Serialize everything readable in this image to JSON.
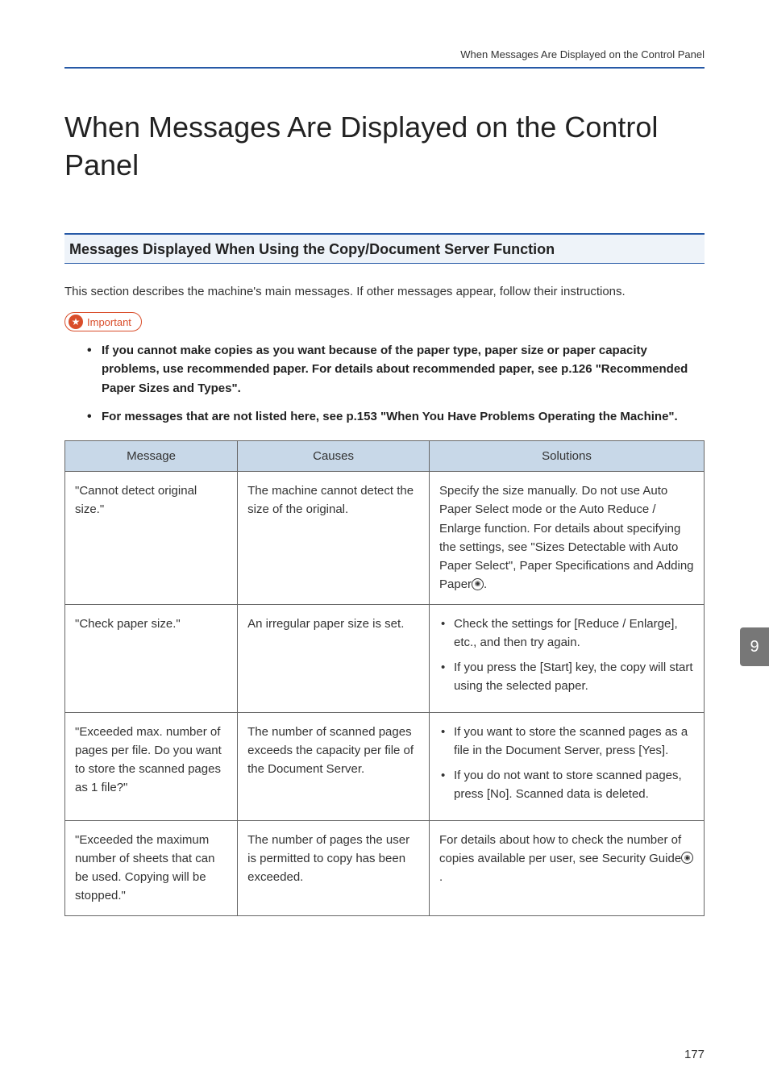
{
  "header": {
    "running_head": "When Messages Are Displayed on the Control Panel"
  },
  "title": "When Messages Are Displayed on the Control Panel",
  "section_heading": "Messages Displayed When Using the Copy/Document Server Function",
  "section_intro": "This section describes the machine's main messages. If other messages appear, follow their instructions.",
  "important": {
    "label": "Important",
    "items": [
      "If you cannot make copies as you want because of the paper type, paper size or paper capacity problems, use recommended paper. For details about recommended paper, see p.126 \"Recommended Paper Sizes and Types\".",
      "For messages that are not listed here, see p.153 \"When You Have Problems Operating the Machine\"."
    ]
  },
  "table": {
    "headers": {
      "message": "Message",
      "causes": "Causes",
      "solutions": "Solutions"
    },
    "rows": [
      {
        "message": "\"Cannot detect original size.\"",
        "causes": "The machine cannot detect the size of the original.",
        "solution_text_prefix": "Specify the size manually. Do not use Auto Paper Select mode or the Auto Reduce / Enlarge function. For details about specifying the settings, see \"Sizes Detectable with Auto Paper Select\", Paper Specifications and Adding Paper",
        "solution_text_suffix": ".",
        "solution_bullets": []
      },
      {
        "message": "\"Check paper size.\"",
        "causes": "An irregular paper size is set.",
        "solution_text_prefix": "",
        "solution_text_suffix": "",
        "solution_bullets": [
          "Check the settings for [Reduce / Enlarge], etc., and then try again.",
          "If you press the [Start] key, the copy will start using the selected paper."
        ]
      },
      {
        "message": "\"Exceeded max. number of pages per file. Do you want to store the scanned pages as 1 file?\"",
        "causes": "The number of scanned pages exceeds the capacity per file of the Document Server.",
        "solution_text_prefix": "",
        "solution_text_suffix": "",
        "solution_bullets": [
          "If you want to store the scanned pages as a file in the Document Server, press [Yes].",
          "If you do not want to store scanned pages, press [No]. Scanned data is deleted."
        ]
      },
      {
        "message": "\"Exceeded the maximum number of sheets that can be used. Copying will be stopped.\"",
        "causes": "The number of pages the user is permitted to copy has been exceeded.",
        "solution_text_prefix": "For details about how to check the number of copies available per user, see Security Guide",
        "solution_text_suffix": ".",
        "solution_bullets": []
      }
    ]
  },
  "side_tab": "9",
  "page_number": "177"
}
